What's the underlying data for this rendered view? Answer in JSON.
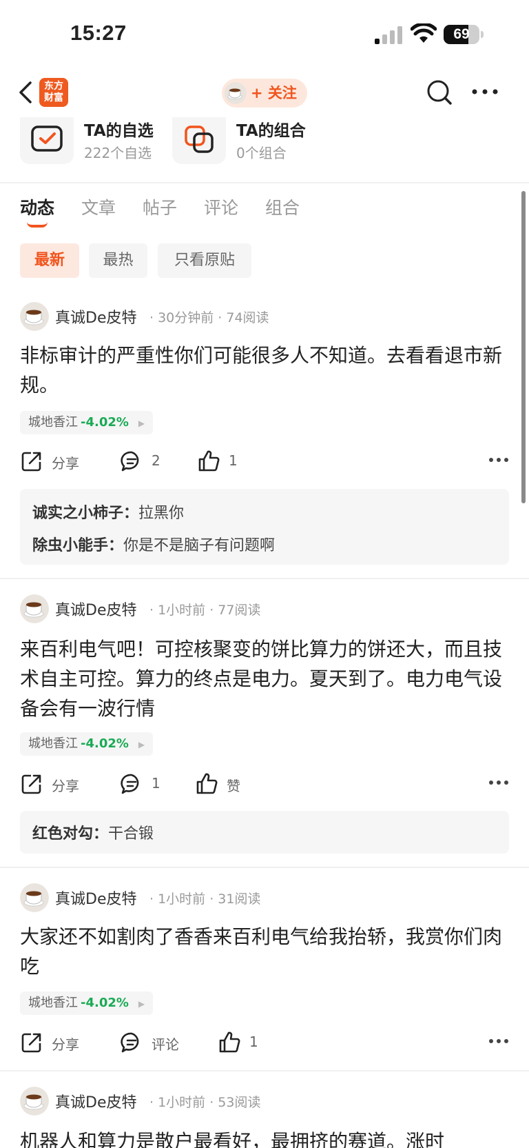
{
  "status_bar": {
    "time": "15:27",
    "battery": "69",
    "battery_level": 0.69
  },
  "nav": {
    "logo_line1": "东方",
    "logo_line2": "财富",
    "follow_label": "+ 关注"
  },
  "shortcuts": [
    {
      "title": "TA的自选",
      "subtitle": "222个自选"
    },
    {
      "title": "TA的组合",
      "subtitle": "0个组合"
    }
  ],
  "tabs": [
    "动态",
    "文章",
    "帖子",
    "评论",
    "组合"
  ],
  "filters": [
    "最新",
    "最热",
    "只看原贴"
  ],
  "posts": [
    {
      "author": "真诚De皮特",
      "meta": "· 30分钟前 · 74阅读",
      "content": "非标审计的严重性你们可能很多人不知道。去看看退市新规。",
      "stock_name": "城地香江",
      "stock_change": "-4.02%",
      "share": "分享",
      "comment_count": "2",
      "like_count": "1",
      "comments": [
        {
          "user": "诚实之小柿子：",
          "text": "拉黑你"
        },
        {
          "user": "除虫小能手：",
          "text": "你是不是脑子有问题啊"
        }
      ]
    },
    {
      "author": "真诚De皮特",
      "meta": "· 1小时前 · 77阅读",
      "content": "来百利电气吧！可控核聚变的饼比算力的饼还大，而且技术自主可控。算力的终点是电力。夏天到了。电力电气设备会有一波行情",
      "stock_name": "城地香江",
      "stock_change": "-4.02%",
      "share": "分享",
      "comment_count": "1",
      "like_count": "赞",
      "comments": [
        {
          "user": "红色对勾：",
          "text": "干合锻"
        }
      ]
    },
    {
      "author": "真诚De皮特",
      "meta": "· 1小时前 · 31阅读",
      "content": "大家还不如割肉了香香来百利电气给我抬轿，我赏你们肉吃",
      "stock_name": "城地香江",
      "stock_change": "-4.02%",
      "share": "分享",
      "comment_count": "评论",
      "like_count": "1",
      "comments": []
    },
    {
      "author": "真诚De皮特",
      "meta": "· 1小时前 · 53阅读",
      "content": "机器人和算力是散户最看好，最拥挤的赛道。涨时"
    }
  ]
}
